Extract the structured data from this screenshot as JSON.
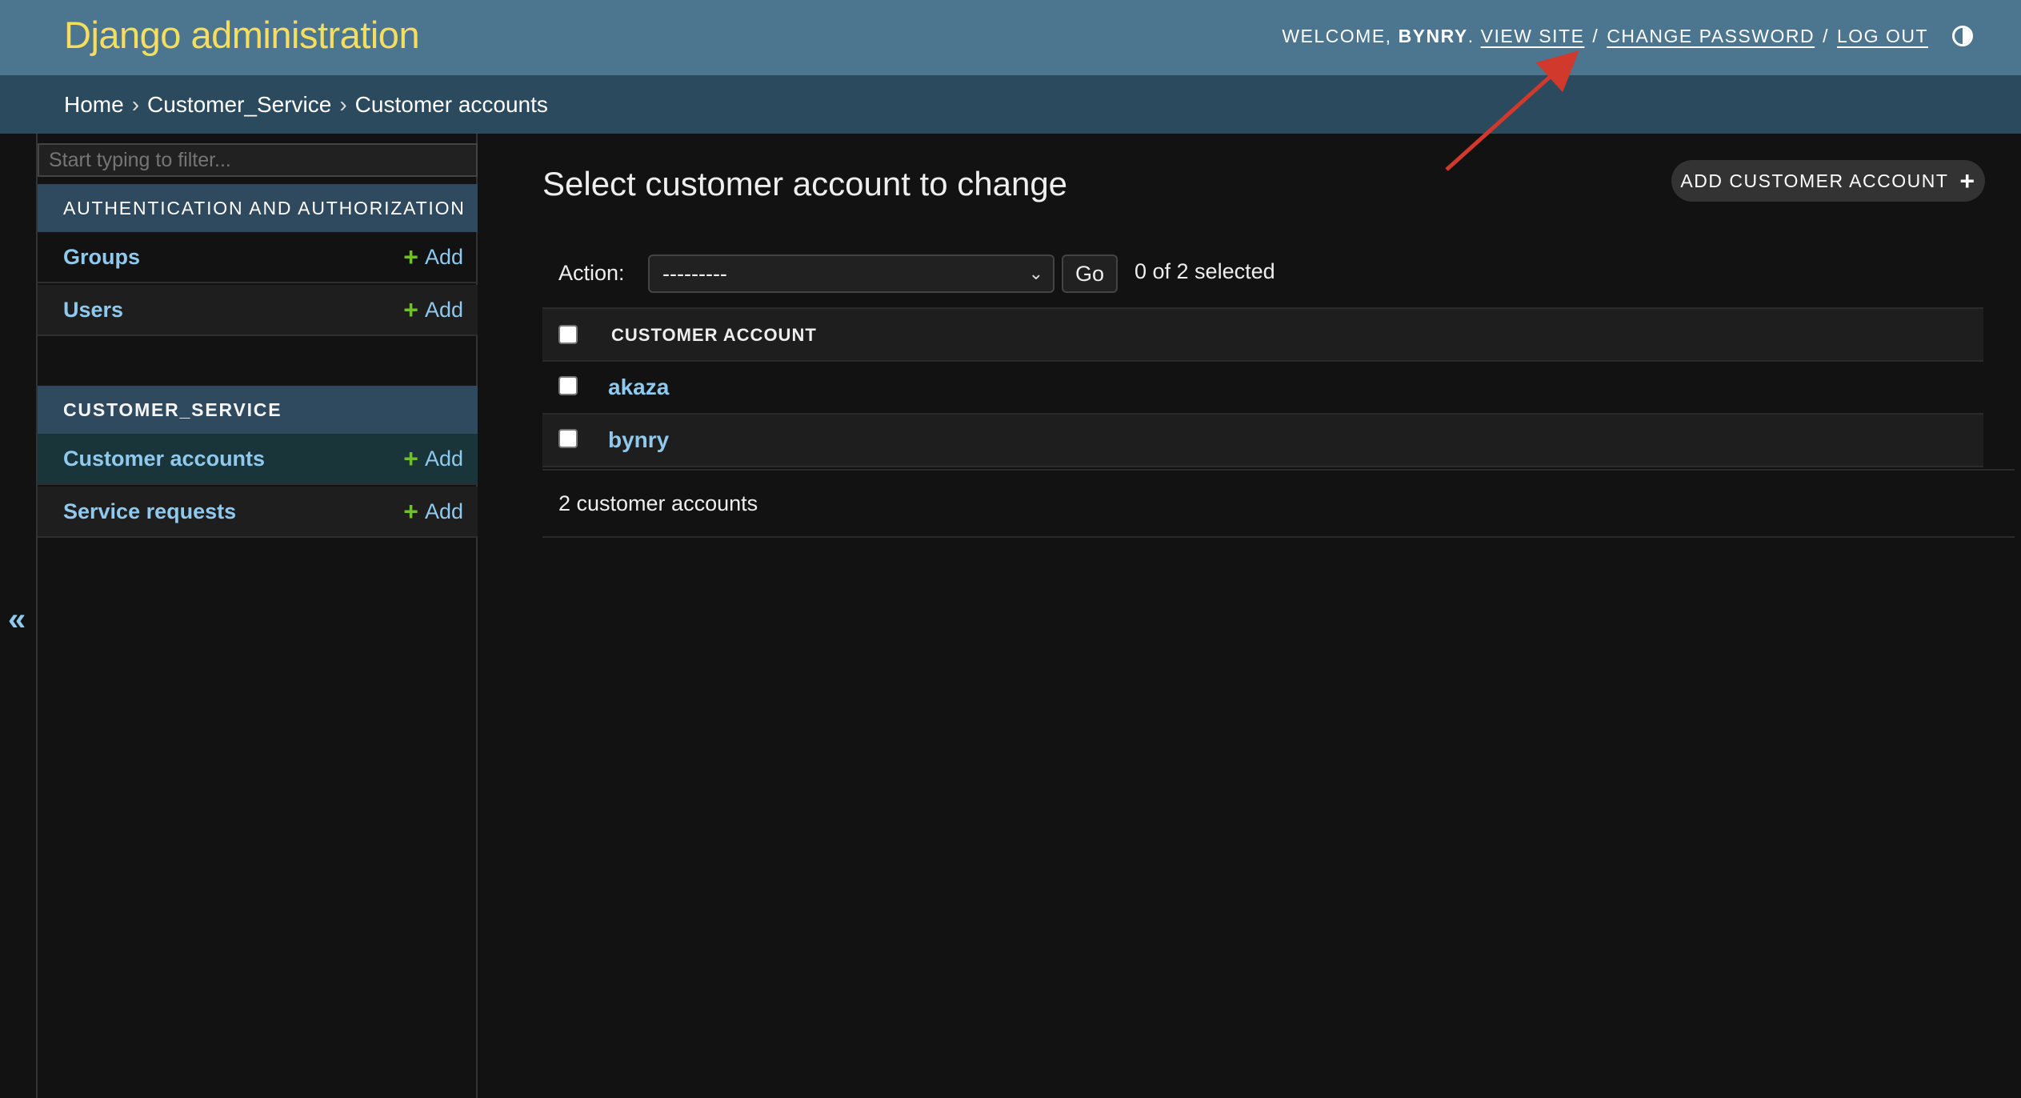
{
  "header": {
    "site_name": "Django administration",
    "welcome": "WELCOME,",
    "username": "BYNRY",
    "view_site": "VIEW SITE",
    "change_password": "CHANGE PASSWORD",
    "log_out": "LOG OUT",
    "separator": "/"
  },
  "breadcrumbs": {
    "items": [
      "Home",
      "Customer_Service",
      "Customer accounts"
    ],
    "separator": "›"
  },
  "sidebar": {
    "filter_placeholder": "Start typing to filter...",
    "modules": [
      {
        "caption": "AUTHENTICATION AND AUTHORIZATION",
        "rows": [
          {
            "name": "Groups",
            "add": "Add"
          },
          {
            "name": "Users",
            "add": "Add"
          }
        ]
      },
      {
        "caption": "CUSTOMER_SERVICE",
        "rows": [
          {
            "name": "Customer accounts",
            "add": "Add",
            "current": true
          },
          {
            "name": "Service requests",
            "add": "Add"
          }
        ]
      }
    ],
    "toggle_icon": "«"
  },
  "main": {
    "title": "Select customer account to change",
    "add_button": "ADD CUSTOMER ACCOUNT",
    "action_label": "Action:",
    "action_selected": "---------",
    "go_label": "Go",
    "selected_count": "0 of 2 selected",
    "table": {
      "column_header": "CUSTOMER ACCOUNT",
      "rows": [
        "akaza",
        "bynry"
      ]
    },
    "paginator": "2 customer accounts"
  },
  "colors": {
    "header_bg": "#4c7590",
    "branding": "#f5dd5d",
    "breadcrumbs_bg": "#2c4a5e",
    "link": "#8fc9ee",
    "add_plus": "#70bf2b",
    "annotation_arrow": "#d0392b"
  },
  "icons": {
    "theme_toggle": "half-circle-icon",
    "add_plus": "plus-icon",
    "select_chevron": "chevron-down-icon",
    "collapse_sidebar": "double-chevron-left-icon"
  }
}
